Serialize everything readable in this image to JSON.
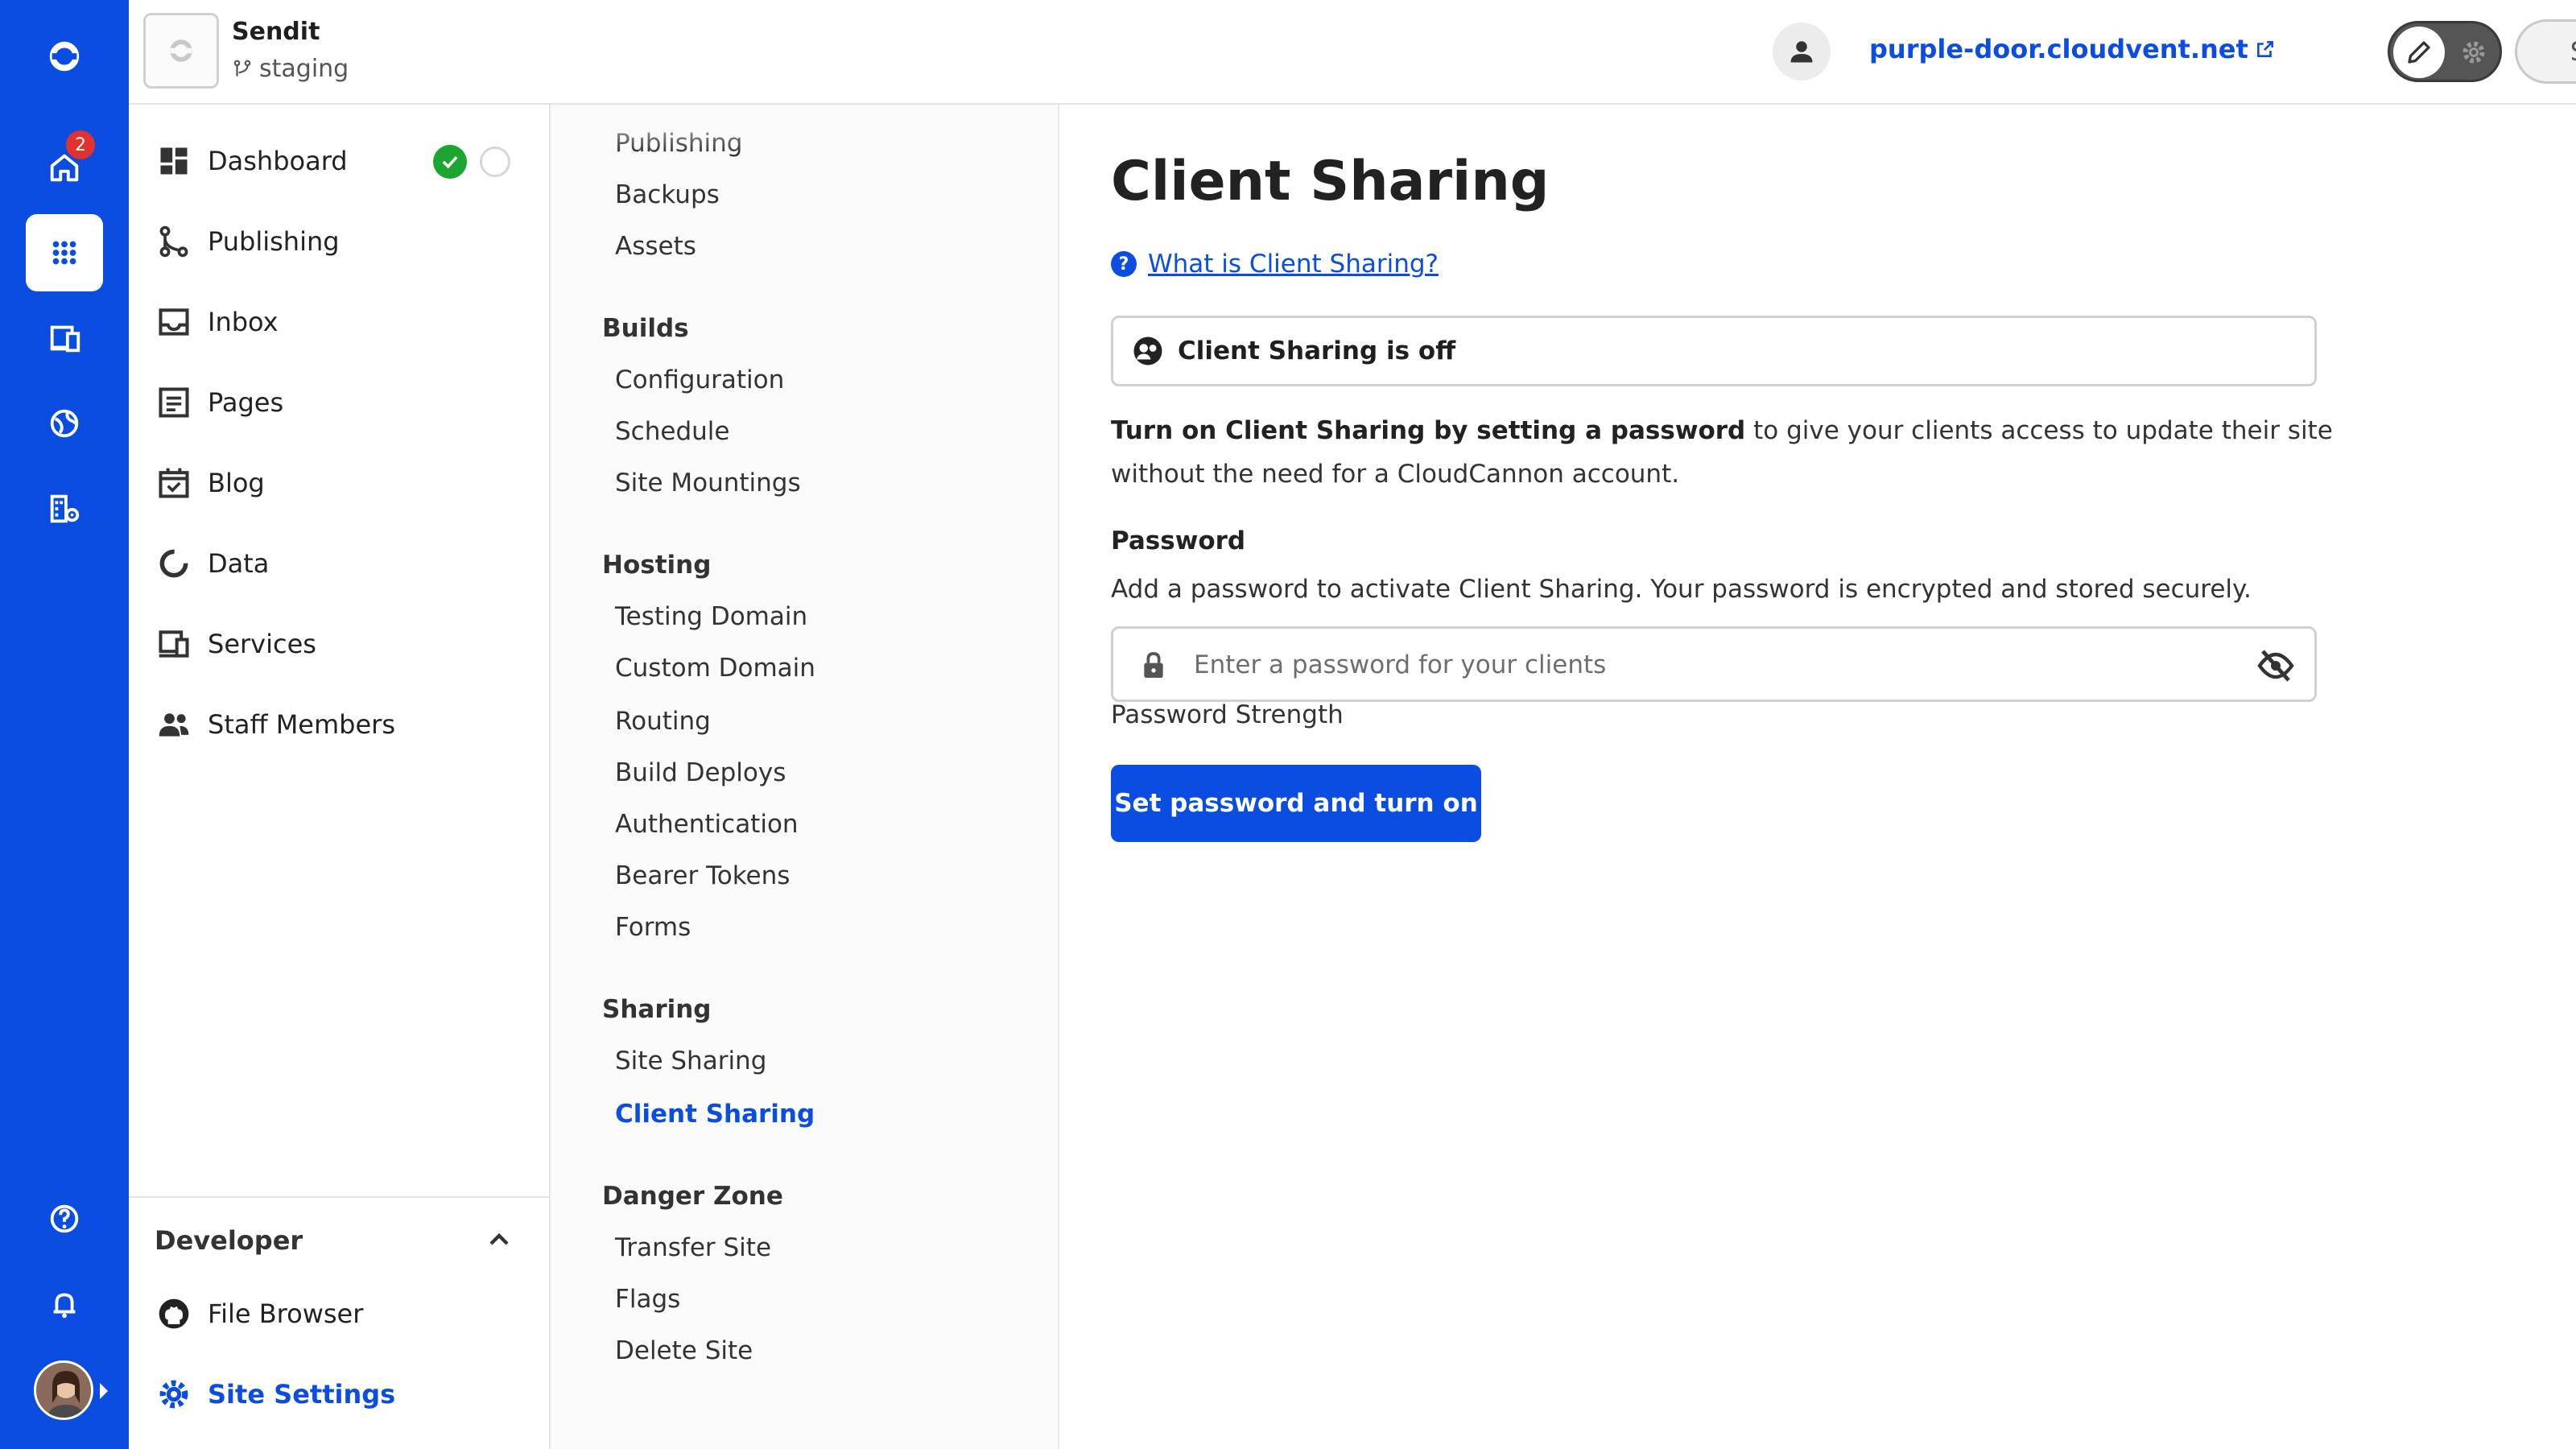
{
  "rail": {
    "home_badge": "2"
  },
  "header": {
    "site_name": "Sendit",
    "branch": "staging",
    "site_url": "purple-door.cloudvent.net",
    "save_label": "Save"
  },
  "sidebar": {
    "items": [
      {
        "label": "Dashboard"
      },
      {
        "label": "Publishing"
      },
      {
        "label": "Inbox"
      },
      {
        "label": "Pages"
      },
      {
        "label": "Blog"
      },
      {
        "label": "Data"
      },
      {
        "label": "Services"
      },
      {
        "label": "Staff Members"
      }
    ],
    "developer": {
      "title": "Developer",
      "items": [
        {
          "label": "File Browser"
        },
        {
          "label": "Site Settings"
        }
      ]
    }
  },
  "subnav": {
    "top_items": [
      "Publishing",
      "Backups",
      "Assets"
    ],
    "groups": [
      {
        "title": "Builds",
        "items": [
          "Configuration",
          "Schedule",
          "Site Mountings"
        ]
      },
      {
        "title": "Hosting",
        "items": [
          "Testing Domain",
          "Custom Domain",
          "Routing",
          "Build Deploys",
          "Authentication",
          "Bearer Tokens",
          "Forms"
        ]
      },
      {
        "title": "Sharing",
        "items": [
          "Site Sharing",
          "Client Sharing"
        ]
      },
      {
        "title": "Danger Zone",
        "items": [
          "Transfer Site",
          "Flags",
          "Delete Site"
        ]
      }
    ]
  },
  "main": {
    "title": "Client Sharing",
    "help_link": "What is Client Sharing?",
    "status": "Client Sharing is off",
    "desc_bold": "Turn on Client Sharing by setting a password",
    "desc_rest": " to give your clients access to update their site without the need for a CloudCannon account.",
    "password_label": "Password",
    "password_help": "Add a password to activate Client Sharing. Your password is encrypted and stored securely.",
    "password_placeholder": "Enter a password for your clients",
    "password_value": "",
    "strength_label": "Password Strength",
    "submit_label": "Set password and turn on"
  },
  "colors": {
    "brand": "#0a4de0",
    "success": "#1da532",
    "badge": "#e0322f"
  }
}
